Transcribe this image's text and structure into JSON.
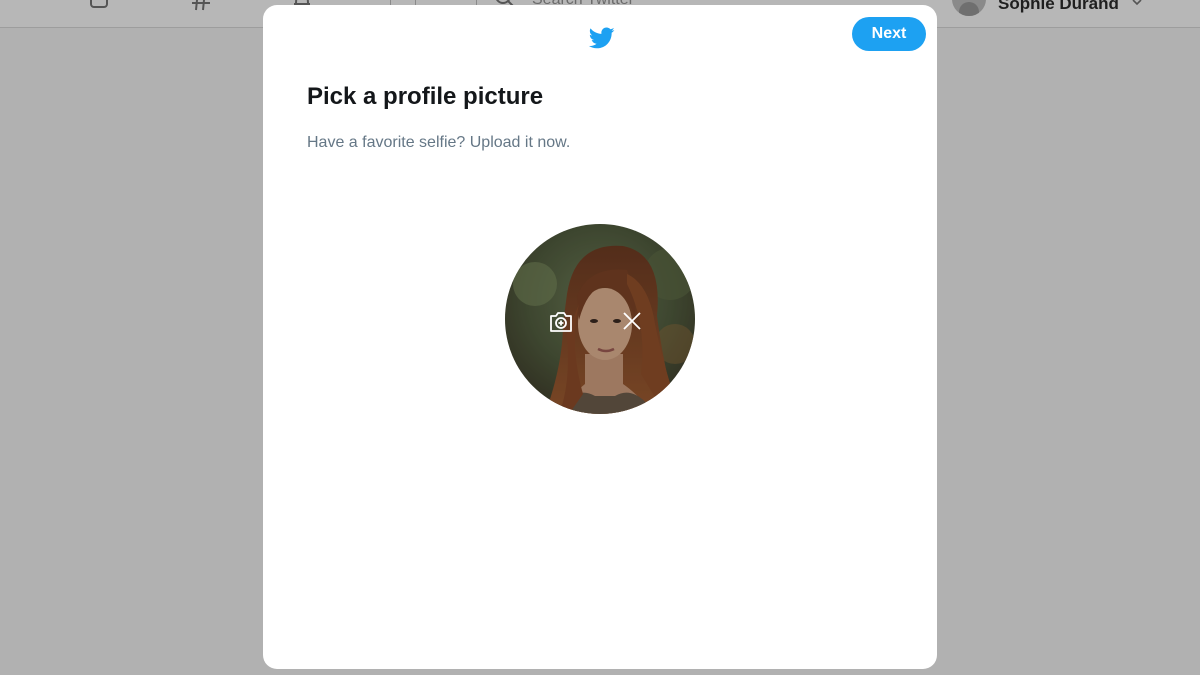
{
  "background": {
    "search_placeholder": "Search Twitter",
    "account_name": "Sophie Durand",
    "nav_icons": [
      "home-icon",
      "hashtag-icon",
      "notifications-icon",
      "messages-icon"
    ]
  },
  "modal": {
    "logo": "twitter-bird-icon",
    "next_label": "Next",
    "title": "Pick a profile picture",
    "subtitle": "Have a favorite selfie? Upload it now.",
    "avatar": {
      "add_photo_icon": "camera-add-icon",
      "remove_icon": "close-icon"
    }
  },
  "colors": {
    "accent": "#1da1f2",
    "title_text": "#14171a",
    "subtitle_text": "#657786",
    "backdrop": "#b1b1b1"
  }
}
